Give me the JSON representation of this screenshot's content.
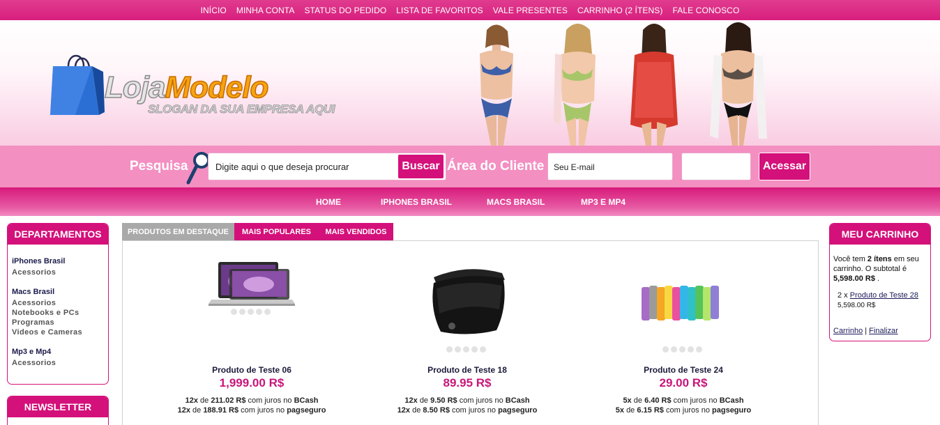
{
  "top_nav": {
    "items": [
      "INÍCIO",
      "MINHA CONTA",
      "STATUS DO PEDIDO",
      "LISTA DE FAVORITOS",
      "VALE PRESENTES",
      "CARRINHO (2 ÍTENS)",
      "FALE CONOSCO"
    ]
  },
  "logo": {
    "word1": "Loja",
    "word2": "Modelo",
    "slogan": "SLOGAN DA SUA EMPRESA AQUI"
  },
  "search": {
    "label": "Pesquisa",
    "placeholder": "Digite aqui o que deseja procurar",
    "button": "Buscar"
  },
  "client_area": {
    "label": "Área do Cliente",
    "email_placeholder": "Seu E-mail",
    "password_value": "",
    "button": "Acessar"
  },
  "main_menu": [
    "HOME",
    "IPHONES BRASIL",
    "MACS BRASIL",
    "MP3 E MP4"
  ],
  "departments": {
    "title": "DEPARTAMENTOS",
    "groups": [
      {
        "name": "iPhones Brasil",
        "subs": [
          "Acessorios"
        ]
      },
      {
        "name": "Macs Brasil",
        "subs": [
          "Acessorios",
          "Notebooks e PCs",
          "Programas",
          "Videos e Cameras"
        ]
      },
      {
        "name": "Mp3 e Mp4",
        "subs": [
          "Acessorios"
        ]
      }
    ]
  },
  "newsletter": {
    "title": "NEWSLETTER"
  },
  "tabs": [
    "PRODUTOS EM DESTAQUE",
    "MAIS POPULARES",
    "MAIS VENDIDOS"
  ],
  "products": [
    {
      "name": "Produto de Teste 06",
      "price": "1,999.00 R$",
      "icon": "laptop-image",
      "inst1": {
        "n": "12x",
        "de": "de",
        "v": "211.02 R$",
        "t": "com juros no",
        "g": "BCash"
      },
      "inst2": {
        "n": "12x",
        "de": "de",
        "v": "188.91 R$",
        "t": "com juros no",
        "g": "pagseguro"
      }
    },
    {
      "name": "Produto de Teste 18",
      "price": "89.95 R$",
      "icon": "bag-image",
      "inst1": {
        "n": "12x",
        "de": "de",
        "v": "9.50 R$",
        "t": "com juros no",
        "g": "BCash"
      },
      "inst2": {
        "n": "12x",
        "de": "de",
        "v": "8.50 R$",
        "t": "com juros no",
        "g": "pagseguro"
      }
    },
    {
      "name": "Produto de Teste 24",
      "price": "29.00 R$",
      "icon": "sock-cases-image",
      "inst1": {
        "n": "5x",
        "de": "de",
        "v": "6.40 R$",
        "t": "com juros no",
        "g": "BCash"
      },
      "inst2": {
        "n": "5x",
        "de": "de",
        "v": "6.15 R$",
        "t": "com juros no",
        "g": "pagseguro"
      }
    }
  ],
  "cart": {
    "title": "MEU CARRINHO",
    "text1": "Você tem",
    "count": "2 ítens",
    "text2": "em seu carrinho. O subtotal é",
    "subtotal": "5,598.00 R$",
    "dot": ".",
    "item_qty": "2 x",
    "item_name": "Produto de Teste 28",
    "item_price": "5,598.00 R$",
    "link_cart": "Carrinho",
    "sep": "|",
    "link_checkout": "Finalizar"
  },
  "colors": {
    "brand_pink": "#d4107a",
    "light_pink": "#f48fc2",
    "price": "#c8167a"
  }
}
